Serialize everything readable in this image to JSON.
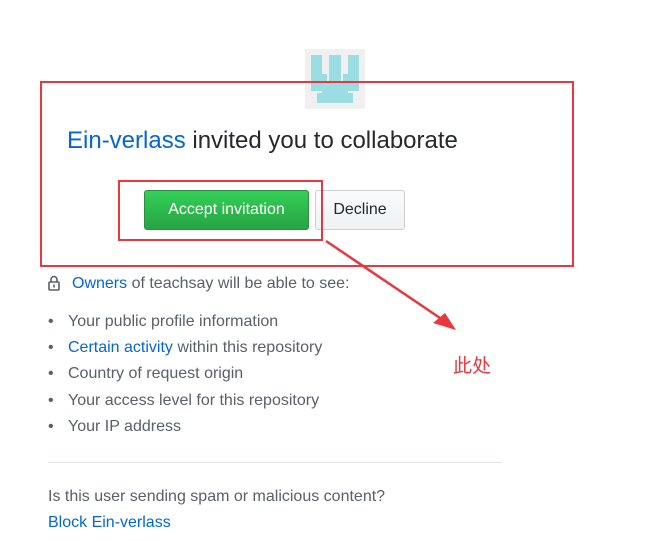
{
  "invite": {
    "inviter": "Ein-verlass",
    "title_rest": " invited you to collaborate",
    "accept_label": "Accept invitation",
    "decline_label": "Decline"
  },
  "permissions": {
    "owners_link": "Owners",
    "owners_rest": " of teachsay will be able to see:",
    "items": [
      {
        "link": "",
        "text": "Your public profile information"
      },
      {
        "link": "Certain activity",
        "text": " within this repository"
      },
      {
        "link": "",
        "text": "Country of request origin"
      },
      {
        "link": "",
        "text": "Your access level for this repository"
      },
      {
        "link": "",
        "text": "Your IP address"
      }
    ]
  },
  "spam": {
    "question": "Is this user sending spam or malicious content?",
    "block_label": "Block Ein-verlass"
  },
  "annotation": {
    "text": "此处",
    "color": "#e8383d"
  },
  "icons": {
    "lock": "lock-icon",
    "avatar": "identicon-avatar"
  },
  "colors": {
    "link": "#0366d6",
    "accept_green": "#28a745",
    "annotation_red": "#e8383d"
  }
}
